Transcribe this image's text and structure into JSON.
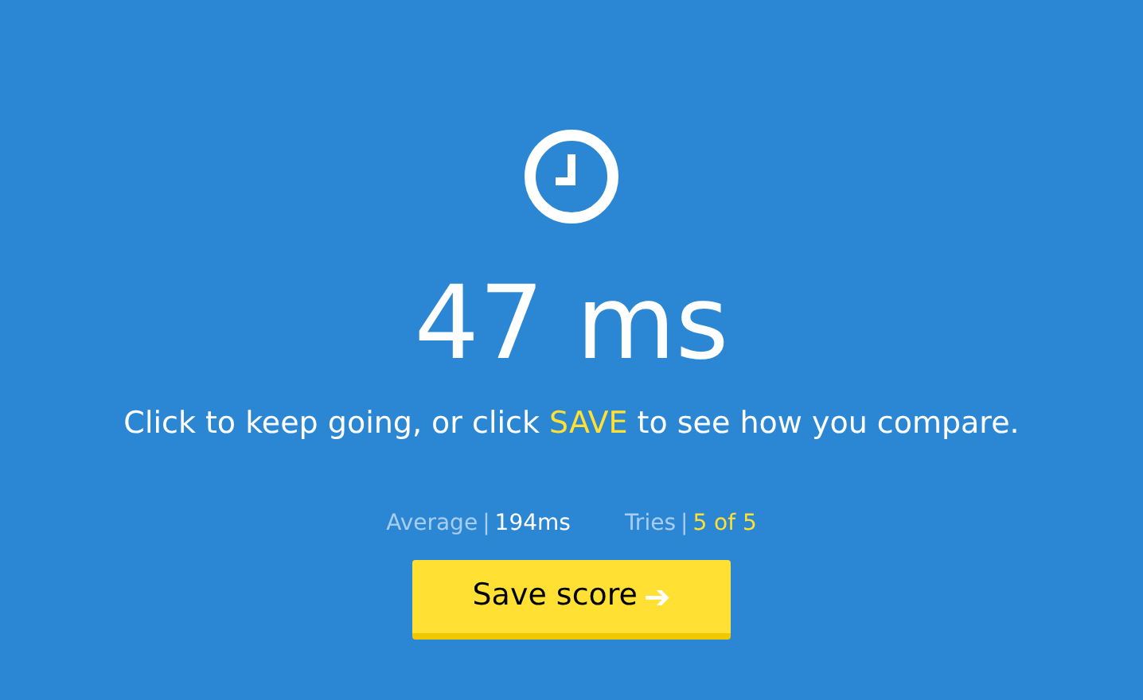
{
  "result": "47 ms",
  "message": {
    "before": "Click to keep going, or click ",
    "highlight": "SAVE",
    "after": " to see how you compare."
  },
  "stats": [
    {
      "label": "Average",
      "separator": "|",
      "value": "194ms",
      "kind": "plain"
    },
    {
      "label": "Tries",
      "separator": "|",
      "value": "5 of 5",
      "kind": "accent"
    }
  ],
  "button": {
    "label": "Save score",
    "icon": "➔"
  }
}
